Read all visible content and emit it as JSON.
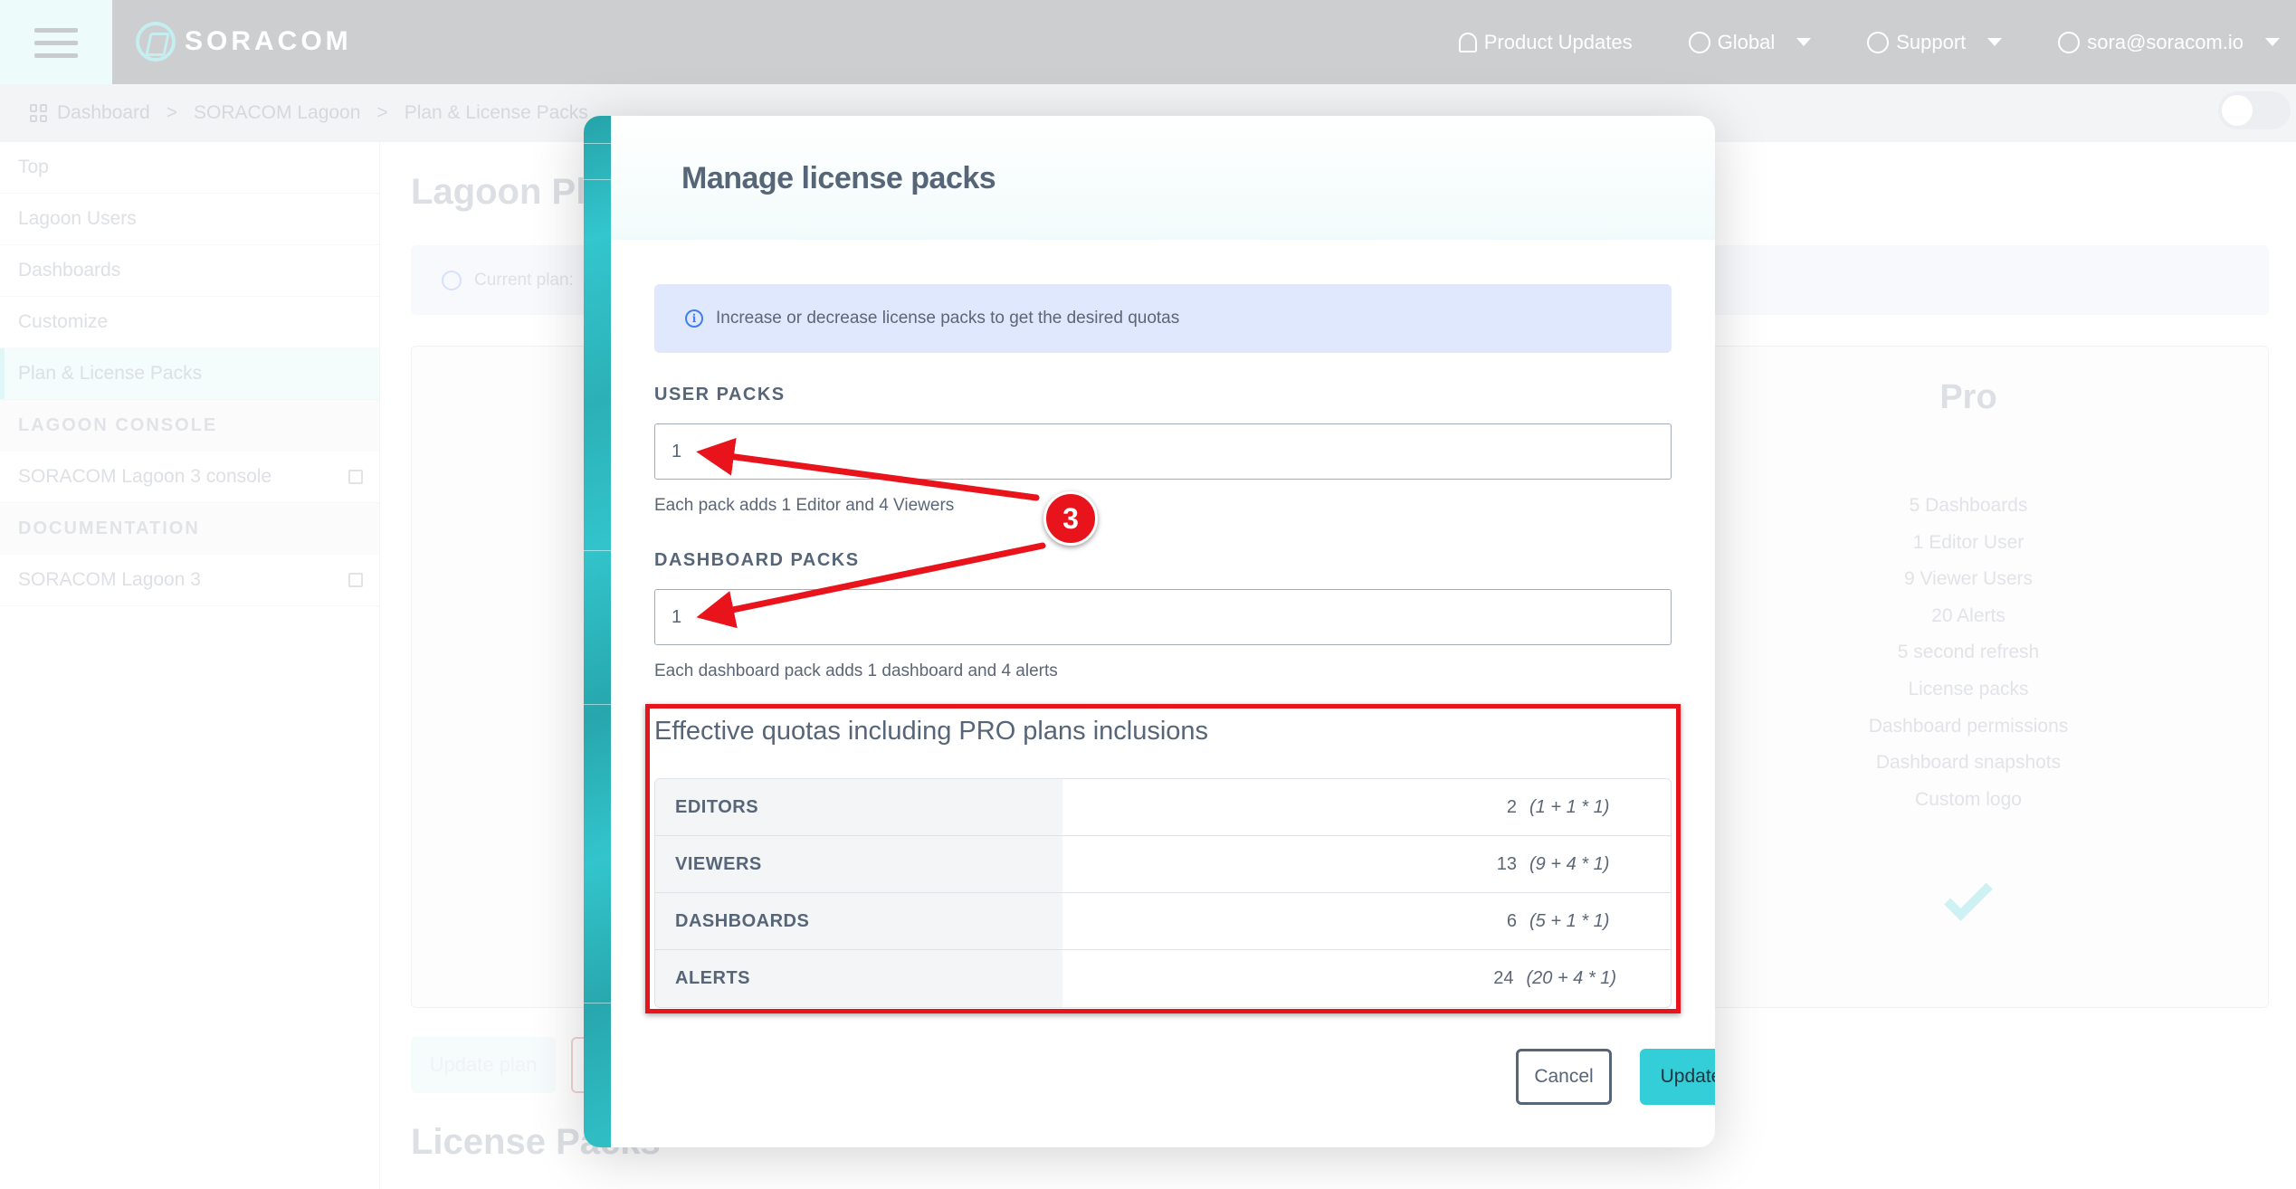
{
  "header": {
    "brand": "SORACOM",
    "nav": [
      {
        "label": "Product Updates",
        "icon": "bell-icon"
      },
      {
        "label": "Global",
        "icon": "globe-icon"
      },
      {
        "label": "Support",
        "icon": "lifebuoy-icon"
      },
      {
        "label": "sora@soracom.io",
        "icon": "user-icon"
      }
    ]
  },
  "breadcrumb": [
    "Dashboard",
    "SORACOM Lagoon",
    "Plan & License Packs"
  ],
  "sidebar": {
    "items": [
      "Top",
      "Lagoon Users",
      "Dashboards",
      "Customize",
      "Plan & License Packs"
    ],
    "active_index": 4,
    "sections": [
      {
        "title": "LAGOON CONSOLE",
        "links": [
          "SORACOM Lagoon 3 console"
        ]
      },
      {
        "title": "DOCUMENTATION",
        "links": [
          "SORACOM Lagoon 3"
        ]
      }
    ]
  },
  "background_page": {
    "title": "Lagoon Pla",
    "banner": "Current plan:",
    "pro_plan": {
      "name": "Pro",
      "features": [
        "5 Dashboards",
        "1 Editor User",
        "9 Viewer Users",
        "20 Alerts",
        "5 second refresh",
        "License packs",
        "Dashboard permissions",
        "Dashboard snapshots",
        "Custom logo"
      ]
    },
    "update_plan_button": "Update plan",
    "license_heading": "License Packs"
  },
  "modal": {
    "title": "Manage license packs",
    "info": "Increase or decrease license packs to get the desired quotas",
    "user_packs": {
      "label": "USER PACKS",
      "value": "1",
      "help": "Each pack adds 1 Editor and 4 Viewers"
    },
    "dashboard_packs": {
      "label": "DASHBOARD PACKS",
      "value": "1",
      "help": "Each dashboard pack adds 1 dashboard and 4 alerts"
    },
    "quotas": {
      "title": "Effective quotas including PRO plans inclusions",
      "rows": [
        {
          "label": "EDITORS",
          "total": "2",
          "formula": "(1 + 1 * 1)"
        },
        {
          "label": "VIEWERS",
          "total": "13",
          "formula": "(9 + 4 * 1)"
        },
        {
          "label": "DASHBOARDS",
          "total": "6",
          "formula": "(5 + 1 * 1)"
        },
        {
          "label": "ALERTS",
          "total": "24",
          "formula": "(20 + 4 * 1)"
        }
      ]
    },
    "cancel_label": "Cancel",
    "update_label": "Update"
  },
  "annotation": {
    "step_number": "3",
    "color": "#e8131b"
  },
  "colors": {
    "accent": "#34ced8",
    "header_bg": "#cdced0",
    "info_bg": "#dfe8fc"
  }
}
